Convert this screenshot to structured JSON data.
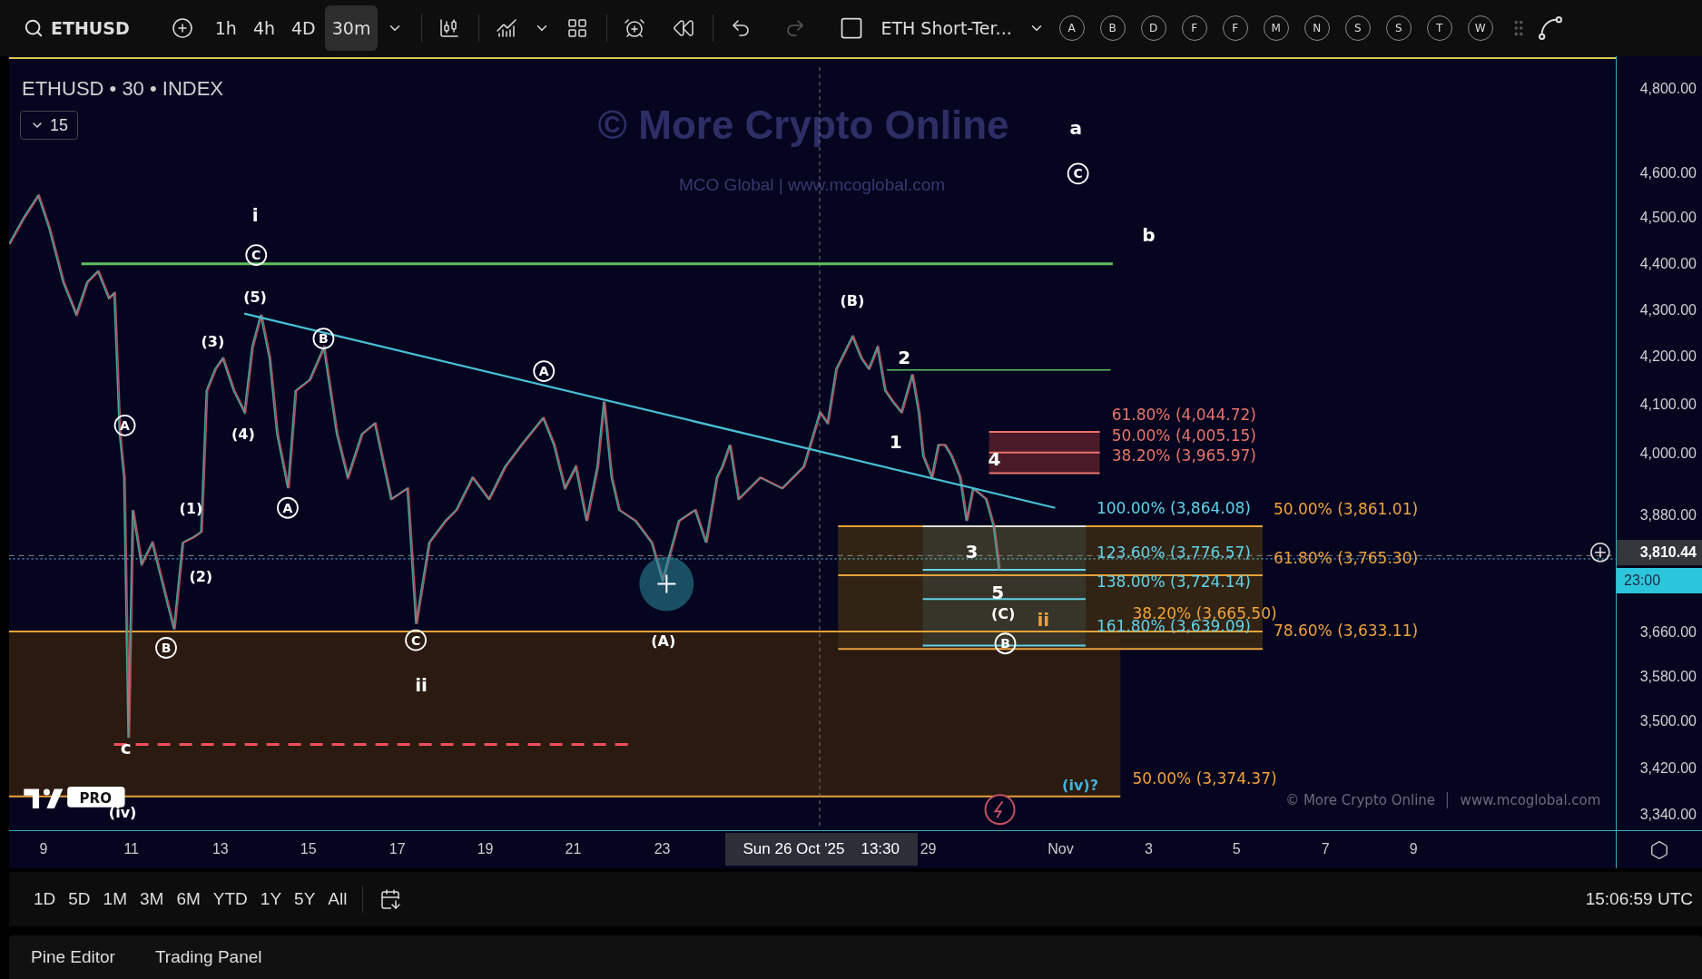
{
  "toolbar": {
    "symbol": "ETHUSD",
    "intervals": [
      {
        "label": "1h",
        "selected": false
      },
      {
        "label": "4h",
        "selected": false
      },
      {
        "label": "4D",
        "selected": false
      },
      {
        "label": "30m",
        "selected": true
      }
    ],
    "layout_name": "ETH Short-Ter...",
    "redo": {
      "disabled": true
    },
    "letters": [
      "A",
      "B",
      "D",
      "F",
      "F",
      "M",
      "N",
      "S",
      "S",
      "T",
      "W"
    ]
  },
  "chart": {
    "legend": "ETHUSD • 30 • INDEX",
    "collapse_count": "15",
    "watermark": "© More Crypto Online",
    "watermark_sub": "MCO Global  |  www.mcoglobal.com",
    "credit": "© More Crypto Online",
    "credit_site": "www.mcoglobal.com",
    "logo_badge": "PRO",
    "wave_labels": [
      {
        "text": "a",
        "kind": "plain",
        "color": "#ffffff"
      },
      {
        "text": "C",
        "kind": "circled",
        "color": "#ffffff"
      },
      {
        "text": "b",
        "kind": "plain",
        "color": "#ffffff"
      },
      {
        "text": "i",
        "kind": "plain",
        "color": "#ffffff"
      },
      {
        "text": "C",
        "kind": "circled",
        "color": "#ffffff"
      },
      {
        "text": "(5)",
        "kind": "plain",
        "color": "#ffffff"
      },
      {
        "text": "(3)",
        "kind": "plain",
        "color": "#ffffff"
      },
      {
        "text": "B",
        "kind": "circled",
        "color": "#ffffff"
      },
      {
        "text": "A",
        "kind": "circled",
        "color": "#ffffff"
      },
      {
        "text": "(B)",
        "kind": "plain",
        "color": "#ffffff"
      },
      {
        "text": "2",
        "kind": "plain",
        "color": "#ffffff"
      },
      {
        "text": "1",
        "kind": "plain",
        "color": "#ffffff"
      },
      {
        "text": "4",
        "kind": "plain",
        "color": "#ffffff"
      },
      {
        "text": "A",
        "kind": "circled",
        "color": "#ffffff"
      },
      {
        "text": "(4)",
        "kind": "plain",
        "color": "#ffffff"
      },
      {
        "text": "(1)",
        "kind": "plain",
        "color": "#ffffff"
      },
      {
        "text": "A",
        "kind": "circled",
        "color": "#ffffff"
      },
      {
        "text": "(2)",
        "kind": "plain",
        "color": "#ffffff"
      },
      {
        "text": "3",
        "kind": "plain",
        "color": "#ffffff"
      },
      {
        "text": "5",
        "kind": "plain",
        "color": "#ffffff"
      },
      {
        "text": "(C)",
        "kind": "plain",
        "color": "#ffffff"
      },
      {
        "text": "ii",
        "kind": "plain",
        "color": "#e8a23a"
      },
      {
        "text": "B",
        "kind": "circled",
        "color": "#ffffff"
      },
      {
        "text": "C",
        "kind": "circled",
        "color": "#ffffff"
      },
      {
        "text": "(A)",
        "kind": "plain",
        "color": "#ffffff"
      },
      {
        "text": "B",
        "kind": "circled",
        "color": "#ffffff"
      },
      {
        "text": "ii",
        "kind": "plain",
        "color": "#ffffff"
      },
      {
        "text": "c",
        "kind": "plain",
        "color": "#ffffff"
      },
      {
        "text": "(iv)",
        "kind": "plain",
        "color": "#ffffff"
      },
      {
        "text": "(iv)?",
        "kind": "plain",
        "color": "#3fb6e0"
      }
    ],
    "fib_labels": [
      {
        "text": "61.80% (4,044.72)",
        "color": "#e8746a"
      },
      {
        "text": "50.00% (4,005.15)",
        "color": "#e8746a"
      },
      {
        "text": "38.20% (3,965.97)",
        "color": "#e8746a"
      },
      {
        "text": "100.00% (3,864.08)",
        "color": "#62d2e6"
      },
      {
        "text": "50.00% (3,861.01)",
        "color": "#f0a23c"
      },
      {
        "text": "123.60% (3,776.57)",
        "color": "#62d2e6"
      },
      {
        "text": "61.80% (3,765.30)",
        "color": "#f0a23c"
      },
      {
        "text": "138.00% (3,724.14)",
        "color": "#62d2e6"
      },
      {
        "text": "38.20% (3,665.50)",
        "color": "#f0a23c"
      },
      {
        "text": "161.80% (3,639.09)",
        "color": "#62d2e6"
      },
      {
        "text": "78.60% (3,633.11)",
        "color": "#f0a23c"
      },
      {
        "text": "50.00% (3,374.37)",
        "color": "#f0a23c"
      }
    ]
  },
  "price_axis": {
    "ticks": [
      "4,800.00",
      "4,600.00",
      "4,500.00",
      "4,400.00",
      "4,300.00",
      "4,200.00",
      "4,100.00",
      "4,000.00",
      "3,880.00",
      "3,660.00",
      "3,580.00",
      "3,500.00",
      "3,420.00",
      "3,340.00"
    ],
    "current_price": "3,810.44",
    "countdown": "23:00"
  },
  "time_axis": {
    "ticks": [
      "9",
      "11",
      "13",
      "15",
      "17",
      "19",
      "21",
      "23",
      "29",
      "Nov",
      "3",
      "5",
      "7",
      "9"
    ],
    "crosshair_date": "Sun 26 Oct '25",
    "crosshair_time": "13:30"
  },
  "range_bar": {
    "ranges": [
      "1D",
      "5D",
      "1M",
      "3M",
      "6M",
      "YTD",
      "1Y",
      "5Y",
      "All"
    ],
    "clock": "15:06:59 UTC"
  },
  "bottom_tabs": [
    "Pine Editor",
    "Trading Panel"
  ]
}
